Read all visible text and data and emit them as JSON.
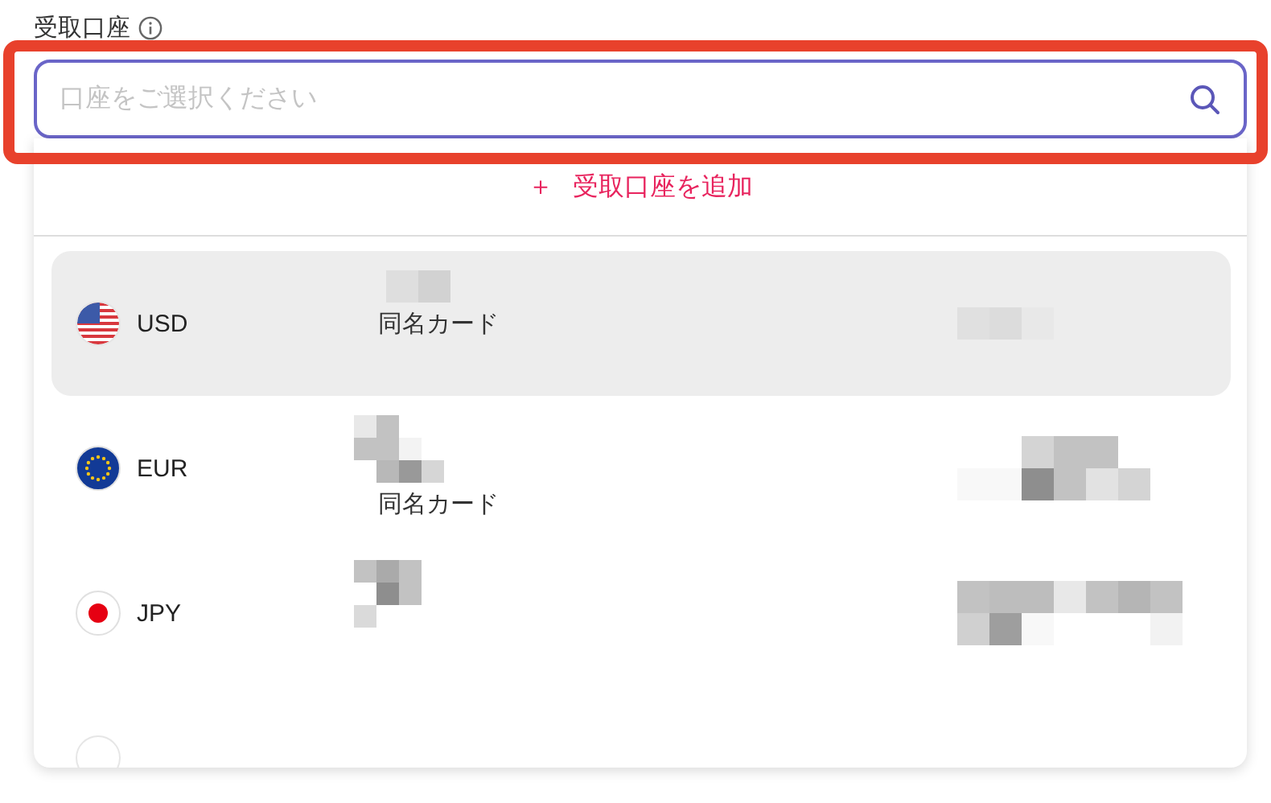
{
  "field_label": "受取口座",
  "account_select": {
    "placeholder": "口座をご選択ください"
  },
  "add_account": {
    "icon": "＋",
    "label": "受取口座を追加"
  },
  "accounts": [
    {
      "kind": "us",
      "currency": "USD",
      "card_type": "同名カード",
      "selected": true
    },
    {
      "kind": "eu",
      "currency": "EUR",
      "card_type": "同名カード",
      "selected": false
    },
    {
      "kind": "jp",
      "currency": "JPY",
      "selected": false
    },
    {
      "kind": "blank",
      "selected": false
    }
  ]
}
